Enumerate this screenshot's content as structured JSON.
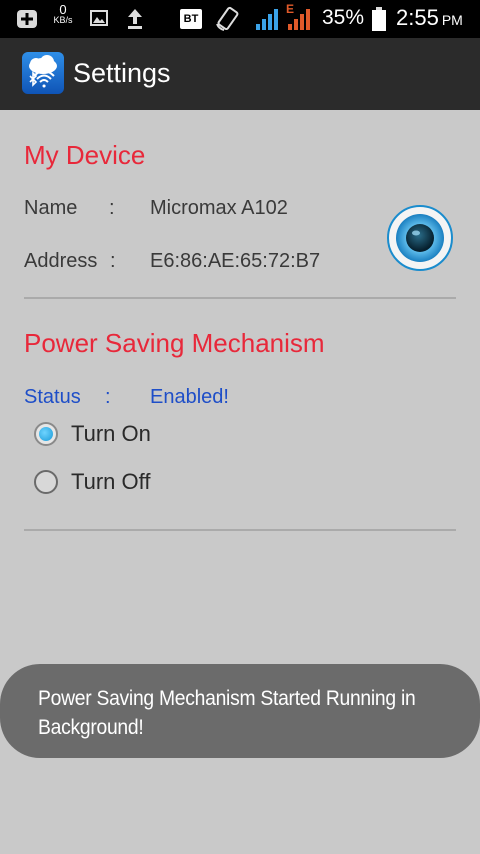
{
  "status_bar": {
    "net_speed_value": "0",
    "net_speed_unit": "KB/s",
    "bt_label": "BT",
    "network_type": "E",
    "battery": "35%",
    "time": "2:55",
    "ampm": "PM",
    "icons": [
      "add-icon",
      "gallery-icon",
      "upload-icon",
      "bt-icon",
      "rotate-icon",
      "signal-icon",
      "battery-icon"
    ]
  },
  "action_bar": {
    "title": "Settings",
    "icon": "bluetooth-wifi-cloud-icon"
  },
  "my_device": {
    "title": "My Device",
    "name_label": "Name",
    "name_sep": ":",
    "name_value": "Micromax A102",
    "address_label": "Address",
    "address_sep": ":",
    "address_value": "E6:86:AE:65:72:B7",
    "eye_icon": "eye-icon"
  },
  "power_saving": {
    "title": "Power Saving Mechanism",
    "status_label": "Status",
    "status_sep": ":",
    "status_value": "Enabled!",
    "options": [
      {
        "label": "Turn On",
        "checked": true
      },
      {
        "label": "Turn Off",
        "checked": false
      }
    ]
  },
  "toast": {
    "message": "Power Saving Mechanism Started Running in Background!"
  },
  "colors": {
    "accent_red": "#e8283a",
    "status_blue": "#1e4ec8",
    "background": "#c9c9c9"
  }
}
